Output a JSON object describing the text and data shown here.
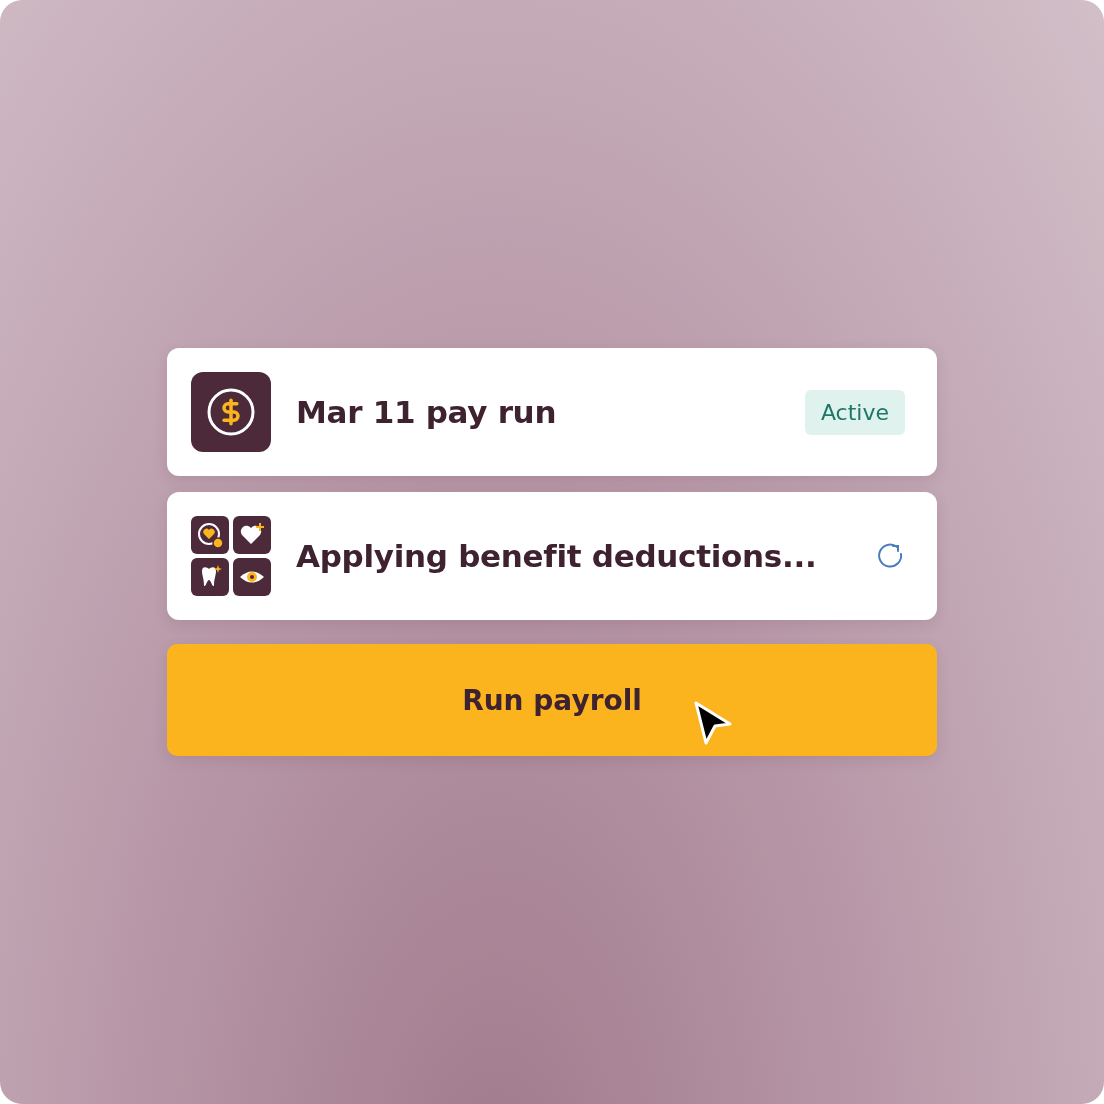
{
  "rows": [
    {
      "kind": "pay_run",
      "title": "Mar 11 pay run",
      "badge": "Active"
    },
    {
      "kind": "benefits",
      "title": "Applying benefit deductions...",
      "loading": true
    }
  ],
  "button": {
    "label": "Run payroll",
    "hovered": true
  }
}
